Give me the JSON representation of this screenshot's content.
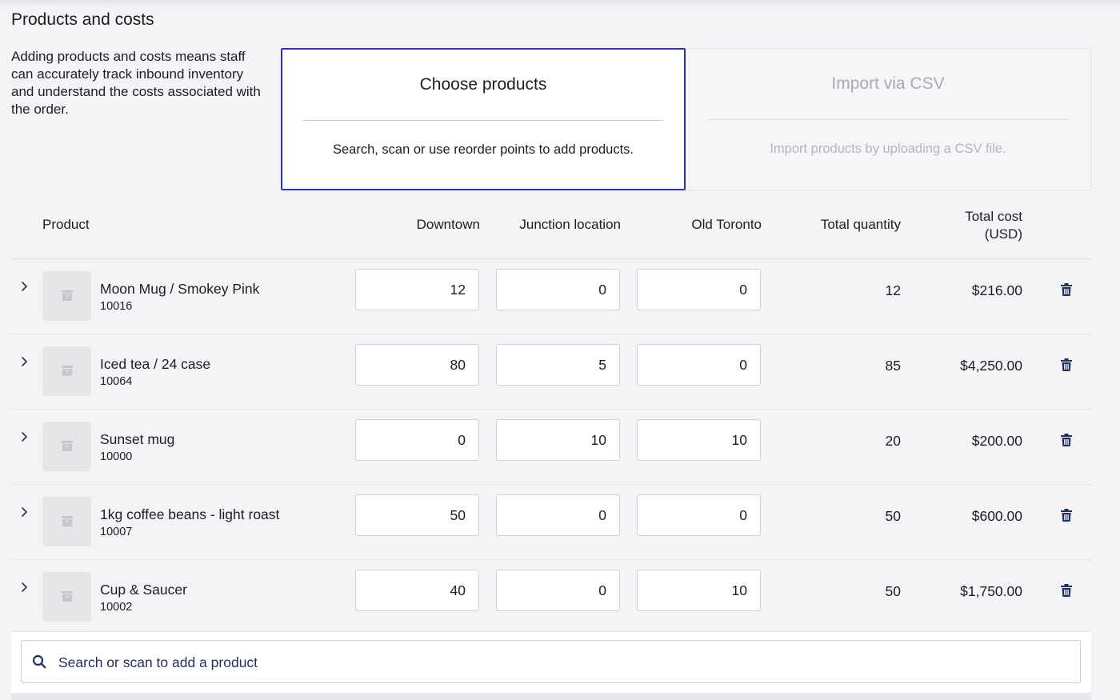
{
  "section": {
    "title": "Products and costs",
    "description": "Adding products and costs means staff can accurately track inbound inventory and understand the costs associated with the order."
  },
  "options": {
    "choose": {
      "title": "Choose products",
      "description": "Search, scan or use reorder points to add products."
    },
    "csv": {
      "title": "Import via CSV",
      "description": "Import products by uploading a CSV file."
    }
  },
  "table": {
    "headers": {
      "product": "Product",
      "downtown": "Downtown",
      "junction": "Junction location",
      "old_toronto": "Old Toronto",
      "total_quantity": "Total quantity",
      "total_cost_line1": "Total cost",
      "total_cost_line2": "(USD)"
    },
    "rows": [
      {
        "name": "Moon Mug / Smokey Pink",
        "sku": "10016",
        "downtown": "12",
        "junction": "0",
        "old_toronto": "0",
        "total_quantity": "12",
        "total_cost": "$216.00"
      },
      {
        "name": "Iced tea / 24 case",
        "sku": "10064",
        "downtown": "80",
        "junction": "5",
        "old_toronto": "0",
        "total_quantity": "85",
        "total_cost": "$4,250.00"
      },
      {
        "name": "Sunset mug",
        "sku": "10000",
        "downtown": "0",
        "junction": "10",
        "old_toronto": "10",
        "total_quantity": "20",
        "total_cost": "$200.00"
      },
      {
        "name": "1kg coffee beans - light roast",
        "sku": "10007",
        "downtown": "50",
        "junction": "0",
        "old_toronto": "0",
        "total_quantity": "50",
        "total_cost": "$600.00"
      },
      {
        "name": "Cup & Saucer",
        "sku": "10002",
        "downtown": "40",
        "junction": "0",
        "old_toronto": "10",
        "total_quantity": "50",
        "total_cost": "$1,750.00"
      }
    ]
  },
  "search": {
    "placeholder": "Search or scan to add a product",
    "value": ""
  },
  "icons": {
    "chevron": "chevron-right-icon",
    "thumbnail": "product-box-icon",
    "trash": "trash-icon",
    "search": "search-icon"
  },
  "colors": {
    "accent": "#2b33c4",
    "icon_navy": "#22305e",
    "text": "#1b1d29",
    "muted": "#a9abb3"
  }
}
